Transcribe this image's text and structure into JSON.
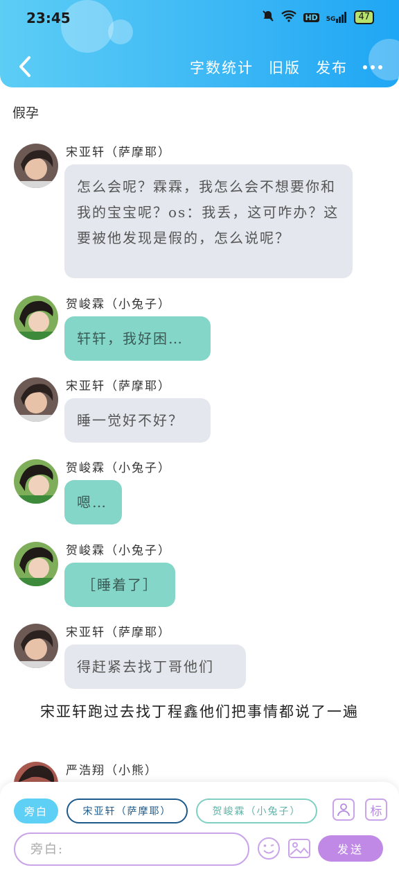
{
  "status_bar": {
    "time": "23:45",
    "battery": "47",
    "hd_label": "HD",
    "signal_label": "5G"
  },
  "header": {
    "word_count_label": "字数统计",
    "old_version_label": "旧版",
    "publish_label": "发布"
  },
  "chapter_title": "假孕",
  "messages": [
    {
      "speaker": "宋亚轩（萨摩耶）",
      "text": "怎么会呢？霖霖，我怎么会不想要你和我的宝宝呢？os：我丢，这可咋办？这要被他发现是假的，怎么说呢？",
      "style": "gray"
    },
    {
      "speaker": "贺峻霖（小兔子）",
      "text": "轩轩，我好困…",
      "style": "teal"
    },
    {
      "speaker": "宋亚轩（萨摩耶）",
      "text": "睡一觉好不好？",
      "style": "gray"
    },
    {
      "speaker": "贺峻霖（小兔子）",
      "text": "嗯…",
      "style": "teal"
    },
    {
      "speaker": "贺峻霖（小兔子）",
      "text": "［睡着了］",
      "style": "teal"
    },
    {
      "speaker": "宋亚轩（萨摩耶）",
      "text": "得赶紧去找丁哥他们",
      "style": "gray"
    }
  ],
  "narration": "宋亚轩跑过去找丁程鑫他们把事情都说了一遍",
  "partial_message": {
    "speaker": "严浩翔（小熊）"
  },
  "composer": {
    "roles": [
      "旁白",
      "宋亚轩（萨摩耶）",
      "贺峻霖（小兔子）"
    ],
    "tag_label": "标",
    "input_placeholder": "旁白:",
    "send_label": "发送"
  },
  "colors": {
    "header_start": "#5ccdf5",
    "header_end": "#1fa6f4",
    "gray_bubble": "#e4e8ee",
    "teal_bubble": "#84d6c8",
    "accent_purple": "#c089e6"
  }
}
